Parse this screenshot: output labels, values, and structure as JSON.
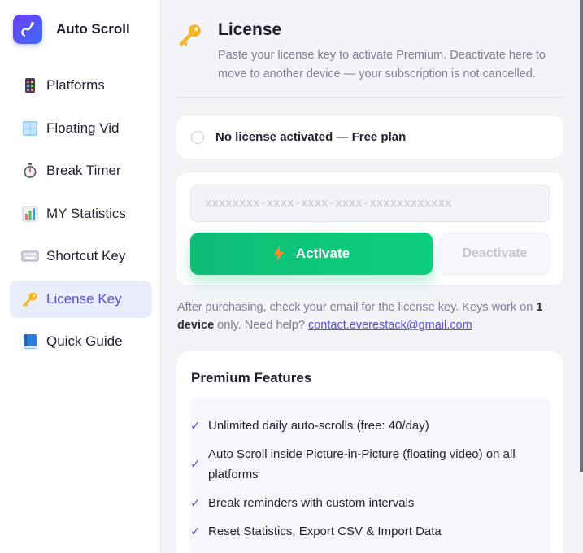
{
  "app": {
    "title": "Auto Scroll",
    "accent": "#5a4fdc",
    "success": "#10c079"
  },
  "sidebar": {
    "items": [
      {
        "label": "Platforms",
        "icon": "mobile-phone-icon",
        "active": false
      },
      {
        "label": "Floating Vid",
        "icon": "window-icon",
        "active": false
      },
      {
        "label": "Break Timer",
        "icon": "stopwatch-icon",
        "active": false
      },
      {
        "label": "MY Statistics",
        "icon": "bar-chart-icon",
        "active": false
      },
      {
        "label": "Shortcut Key",
        "icon": "keyboard-icon",
        "active": false
      },
      {
        "label": "License Key",
        "icon": "key-icon",
        "active": true
      },
      {
        "label": "Quick Guide",
        "icon": "book-icon",
        "active": false
      }
    ]
  },
  "license": {
    "title": "License",
    "subtitle": "Paste your license key to activate Premium. Deactivate here to move to another device — your subscription is not cancelled.",
    "status": "No license activated — Free plan",
    "input_placeholder": "xxxxxxxx-xxxx-xxxx-xxxx-xxxxxxxxxxxx",
    "input_value": "",
    "activate_label": "Activate",
    "deactivate_label": "Deactivate",
    "help": {
      "part1": "After purchasing, check your email for the license key. Keys work on ",
      "bold1": "1 device",
      "part2": " only. Need help? ",
      "email": "contact.everestack@gmail.com"
    }
  },
  "features": {
    "title": "Premium Features",
    "check": "✓",
    "items": [
      "Unlimited daily auto-scrolls (free: 40/day)",
      "Auto Scroll inside Picture-in-Picture (floating video) on all platforms",
      "Break reminders with custom intervals",
      "Reset Statistics, Export CSV & Import Data"
    ]
  }
}
